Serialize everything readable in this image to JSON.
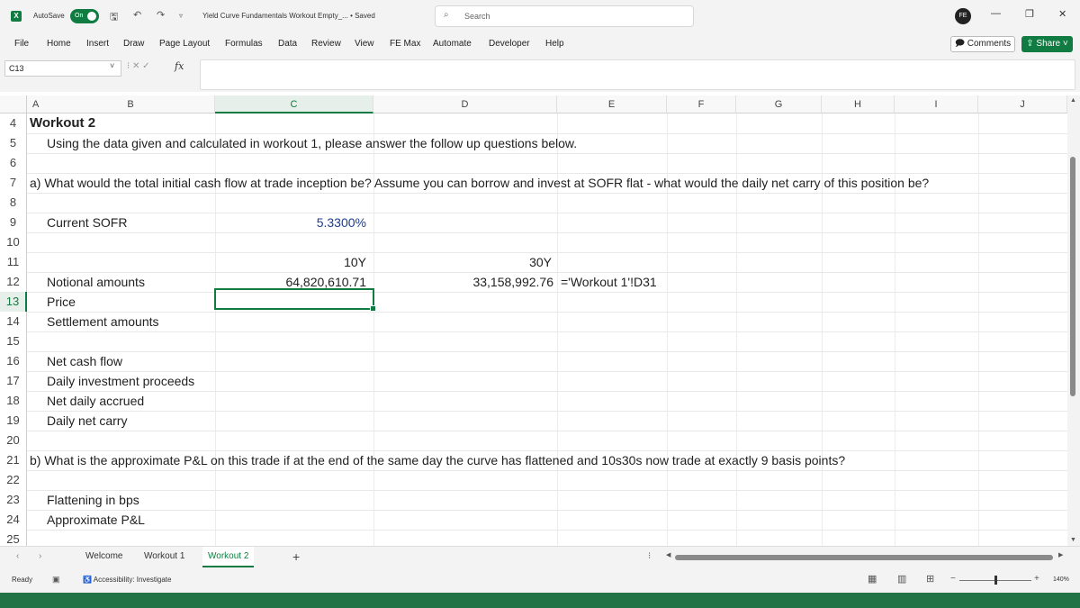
{
  "titlebar": {
    "app_icon": "X",
    "autosave_label": "AutoSave",
    "autosave_state": "On",
    "doc_title": "Yield Curve Fundamentals Workout Empty_... • Saved",
    "search_placeholder": "Search",
    "profile_initials": "FE",
    "minimize": "—",
    "restore": "❐",
    "close": "✕"
  },
  "menu": {
    "items": [
      "File",
      "Home",
      "Insert",
      "Draw",
      "Page Layout",
      "Formulas",
      "Data",
      "Review",
      "View",
      "FE Max",
      "Automate",
      "Developer",
      "Help"
    ],
    "comments_label": "Comments",
    "share_label": "Share"
  },
  "formula_bar": {
    "name_box": "C13",
    "fx_label": "fx",
    "formula": ""
  },
  "grid": {
    "columns": [
      "A",
      "B",
      "C",
      "D",
      "E",
      "F",
      "G",
      "H",
      "I",
      "J"
    ],
    "selected_column": "C",
    "selected_row": "13",
    "rows": [
      "4",
      "5",
      "6",
      "7",
      "8",
      "9",
      "10",
      "11",
      "12",
      "13",
      "14",
      "15",
      "16",
      "17",
      "18",
      "19",
      "20",
      "21",
      "22",
      "23",
      "24",
      "25"
    ],
    "cells": {
      "a4": "Workout 2",
      "b5": "Using the data given and calculated in workout 1, please answer the follow up questions below.",
      "a7": "a) What would the total initial cash flow at trade inception be? Assume you can borrow and invest at SOFR flat - what would the daily net carry of this position be?",
      "b9": "Current SOFR",
      "c9": "5.3300%",
      "c11": "10Y",
      "d11": "30Y",
      "b12": "Notional amounts",
      "c12": "64,820,610.71",
      "d12": "33,158,992.76",
      "e12": "='Workout 1'!D31",
      "b13": "Price",
      "b14": "Settlement amounts",
      "b16": "Net cash flow",
      "b17": "Daily investment proceeds",
      "b18": "Net daily accrued",
      "b19": "Daily net carry",
      "a21": "b) What is the approximate P&L on this trade if at the end of the same day the curve has flattened and 10s30s now trade at exactly 9 basis points?",
      "b23": "Flattening in bps",
      "b24": "Approximate P&L"
    }
  },
  "sheets": {
    "tabs": [
      "Welcome",
      "Workout 1",
      "Workout 2"
    ],
    "active": "Workout 2",
    "add_label": "+"
  },
  "status": {
    "ready": "Ready",
    "accessibility": "Accessibility: Investigate",
    "zoom": "140%"
  },
  "colors": {
    "accent": "#107c41",
    "chrome": "#f3f3f3",
    "status_green": "#217346",
    "input_blue": "#1f3c88"
  }
}
